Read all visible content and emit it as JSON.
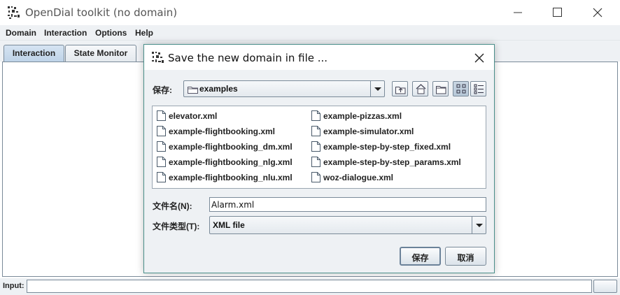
{
  "app": {
    "title": "OpenDial toolkit (no domain)"
  },
  "menu": {
    "items": [
      "Domain",
      "Interaction",
      "Options",
      "Help"
    ]
  },
  "tabs": [
    {
      "label": "Interaction",
      "active": true
    },
    {
      "label": "State Monitor",
      "active": false
    }
  ],
  "input_bar": {
    "label": "Input:",
    "value": ""
  },
  "dialog": {
    "title": "Save the new domain in file ...",
    "look_in_label": "保存:",
    "look_in_value": "examples",
    "files": [
      "elevator.xml",
      "example-flightbooking.xml",
      "example-flightbooking_dm.xml",
      "example-flightbooking_nlg.xml",
      "example-flightbooking_nlu.xml",
      "example-pizzas.xml",
      "example-simulator.xml",
      "example-step-by-step_fixed.xml",
      "example-step-by-step_params.xml",
      "woz-dialogue.xml"
    ],
    "file_name_label": "文件名(N):",
    "file_name_value": "Alarm.xml",
    "file_type_label": "文件类型(T):",
    "file_type_value": "XML file",
    "save_button": "保存",
    "cancel_button": "取消"
  },
  "colors": {
    "dialog_border": "#4a8f8a",
    "panel_bg": "#eef1f4",
    "control_border": "#7a8a99"
  }
}
